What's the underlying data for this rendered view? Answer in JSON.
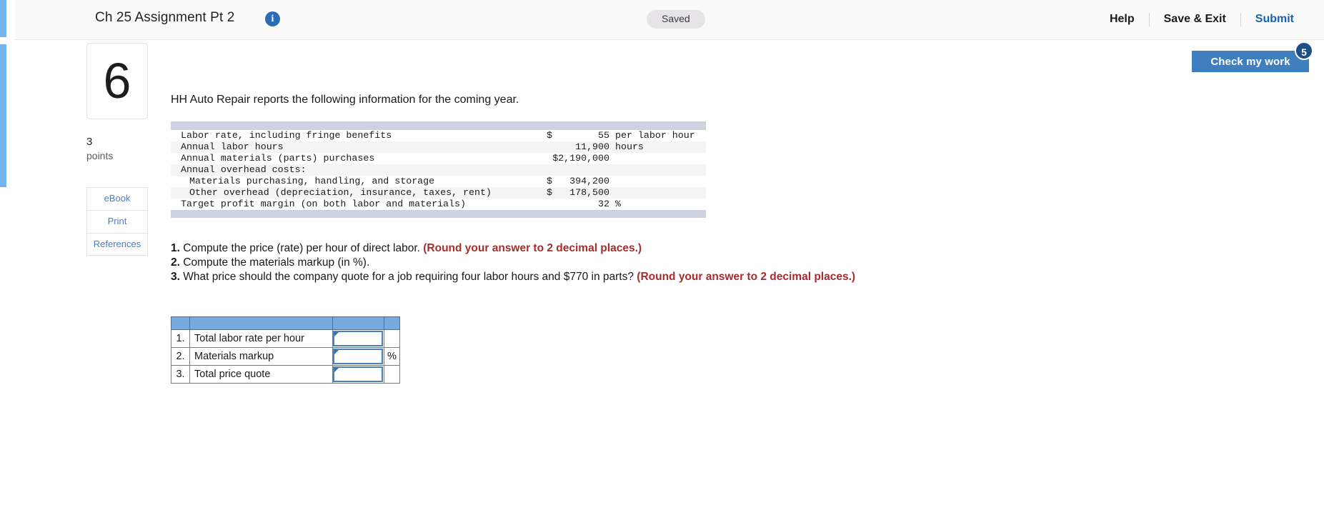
{
  "window": {
    "header": {
      "title": "Ch 25 Assignment Pt 2",
      "info_icon": "info-icon",
      "status_pill": "Saved",
      "links": [
        {
          "label": "Help",
          "accent": "#1a1a1a"
        },
        {
          "label": "Save & Exit",
          "accent": "#1a1a1a"
        },
        {
          "label": "Submit",
          "accent": "#1862ab"
        }
      ]
    },
    "check_my_work": {
      "label": "Check my work",
      "badge_count": "5",
      "button_color": "#3f7fbf",
      "badge_color": "#1b4f86"
    }
  },
  "sidebar": {
    "question_number": "6",
    "points_value": "3",
    "points_label": "points",
    "buttons": [
      {
        "label": "eBook"
      },
      {
        "label": "Print"
      },
      {
        "label": "References"
      }
    ]
  },
  "main": {
    "intro": "HH Auto Repair reports the following information for the coming year.",
    "facts_table": {
      "rows": [
        {
          "label": "Labor rate, including fringe benefits",
          "dollar": "$",
          "value": "55",
          "unit": "per labor hour",
          "shade": false,
          "indent": false
        },
        {
          "label": "Annual labor hours",
          "dollar": "",
          "value": "11,900",
          "unit": "hours",
          "shade": true,
          "indent": false
        },
        {
          "label": "Annual materials (parts) purchases",
          "dollar": "",
          "value": "$2,190,000",
          "unit": "",
          "shade": false,
          "indent": false
        },
        {
          "label": "Annual overhead costs:",
          "dollar": "",
          "value": "",
          "unit": "",
          "shade": true,
          "indent": false
        },
        {
          "label": "Materials purchasing, handling, and storage",
          "dollar": "$",
          "value": "394,200",
          "unit": "",
          "shade": false,
          "indent": true
        },
        {
          "label": "Other overhead (depreciation, insurance, taxes, rent)",
          "dollar": "$",
          "value": "178,500",
          "unit": "",
          "shade": true,
          "indent": true
        },
        {
          "label": "Target profit margin (on both labor and materials)",
          "dollar": "",
          "value": "32",
          "unit": "%",
          "shade": false,
          "indent": false
        }
      ]
    },
    "requirements": [
      {
        "num": "1.",
        "text": "Compute the price (rate) per hour of direct labor.",
        "hint": "(Round your answer to 2 decimal places.)"
      },
      {
        "num": "2.",
        "text": "Compute the materials markup (in %).",
        "hint": ""
      },
      {
        "num": "3.",
        "text": "What price should the company quote for a job requiring four labor hours and $770 in parts?",
        "hint": "(Round your answer to 2 decimal places.)"
      }
    ],
    "answer_table": {
      "header_cells": [
        "",
        "",
        "",
        ""
      ],
      "rows": [
        {
          "num": "1.",
          "label": "Total labor rate per hour",
          "value": "",
          "unit": ""
        },
        {
          "num": "2.",
          "label": "Materials markup",
          "value": "",
          "unit": "%"
        },
        {
          "num": "3.",
          "label": "Total price quote",
          "value": "",
          "unit": ""
        }
      ]
    }
  }
}
